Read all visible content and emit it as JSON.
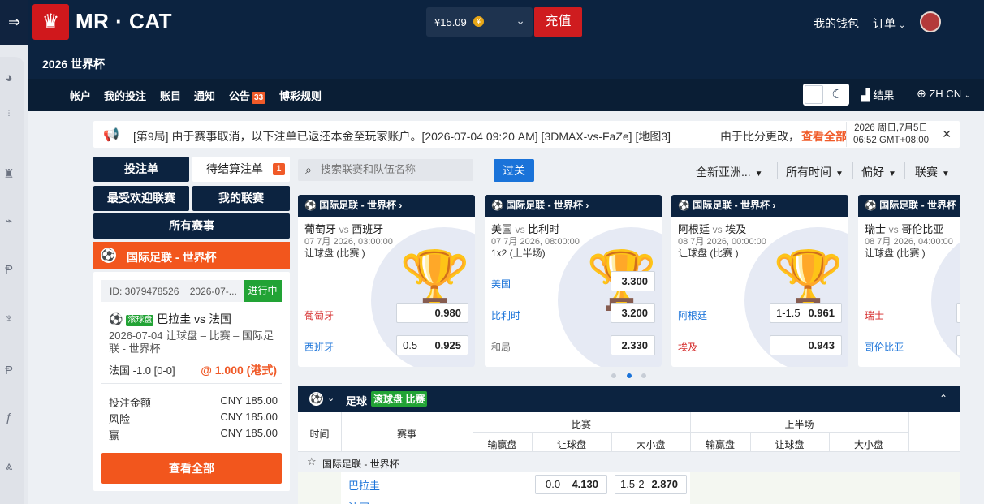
{
  "header": {
    "brand": "MR · CAT",
    "subtitle": "2026 世界杯",
    "balance": "¥15.09",
    "recharge": "充值",
    "wallet": "我的钱包",
    "orders": "订单"
  },
  "nav": {
    "items": [
      "帐户",
      "我的投注",
      "账目",
      "通知",
      "公告",
      "博彩规则"
    ],
    "announce_count": "33",
    "results": "结果",
    "lang": "ZH CN"
  },
  "marquee": {
    "text": "[第9局]      由于赛事取消，以下注单已返还本金至玩家账户。[2026-07-04 09:20 AM] [3DMAX-vs-FaZe] [地图3]",
    "text2": "由于比分更改，",
    "view_all": "查看全部",
    "date_line1": "2026 周日,7月5日",
    "date_line2": "06:52 GMT+08:00"
  },
  "left": {
    "tab_betslip": "投注单",
    "tab_pending": "待结算注单",
    "pending_count": "1",
    "btn_popular": "最受欢迎联赛",
    "btn_my_leagues": "我的联赛",
    "btn_all": "所有赛事",
    "league": "国际足联 - 世界杯",
    "bet": {
      "id": "ID: 3079478526",
      "date": "2026-07-...",
      "status": "进行中",
      "roll_tag": "滚球盘",
      "match": "巴拉圭 vs 法国",
      "desc": "2026-07-04 让球盘 – 比赛 – 国际足联 - 世界杯",
      "selection": "法国 -1.0 [0-0]",
      "odds": "@ 1.000 (港式)",
      "stake_label": "投注金额",
      "stake_value": "CNY 185.00",
      "risk_label": "风险",
      "risk_value": "CNY 185.00",
      "win_label": "赢",
      "win_value": "CNY 185.00",
      "view_all": "查看全部"
    }
  },
  "filters": {
    "search_placeholder": "搜索联赛和队伍名称",
    "filter_btn": "过关",
    "odds_type": "全新亚洲...",
    "time": "所有时间",
    "prefs": "偏好",
    "leagues": "联赛"
  },
  "cards": [
    {
      "league": "国际足联 - 世界杯",
      "home": "葡萄牙",
      "away": "西班牙",
      "vs": "vs",
      "time": "07 7月 2026, 03:00:00",
      "market": "让球盘 (比赛 )",
      "rows": [
        {
          "label": "葡萄牙",
          "line": "",
          "odds": "0.980"
        },
        {
          "label": "西班牙",
          "line": "0.5",
          "odds": "0.925"
        }
      ]
    },
    {
      "league": "国际足联 - 世界杯",
      "home": "美国",
      "away": "比利时",
      "vs": "vs",
      "time": "07 7月 2026, 08:00:00",
      "market": "1x2 (上半场)",
      "rows": [
        {
          "label": "美国",
          "line": "",
          "odds": "3.300"
        },
        {
          "label": "比利时",
          "line": "",
          "odds": "3.200"
        },
        {
          "label": "和局",
          "line": "",
          "odds": "2.330"
        }
      ]
    },
    {
      "league": "国际足联 - 世界杯",
      "home": "阿根廷",
      "away": "埃及",
      "vs": "vs",
      "time": "08 7月 2026, 00:00:00",
      "market": "让球盘 (比赛 )",
      "rows": [
        {
          "label": "阿根廷",
          "line": "1-1.5",
          "odds": "0.961"
        },
        {
          "label": "埃及",
          "line": "",
          "odds": "0.943"
        }
      ]
    },
    {
      "league": "国际足联 - 世界杯",
      "home": "瑞士",
      "away": "哥伦比亚",
      "vs": "vs",
      "time": "08 7月 2026, 04:00:00",
      "market": "让球盘 (比赛 )",
      "rows": [
        {
          "label": "瑞士",
          "line": "",
          "odds": ""
        },
        {
          "label": "哥伦比亚",
          "line": "",
          "odds": ""
        }
      ]
    }
  ],
  "table": {
    "sport": "足球",
    "mode": "滚球盘 比赛",
    "col_time": "时间",
    "col_event": "赛事",
    "group_full": "比赛",
    "group_half": "上半场",
    "sub_cols": [
      "输赢盘",
      "让球盘",
      "大小盘"
    ],
    "league": "国际足联 - 世界杯",
    "home": "巴拉圭",
    "away": "法国",
    "hdp_line": "0.0",
    "hdp_odds": "4.130",
    "ou_line": "1.5-2",
    "ou_odds": "2.870"
  },
  "colors": {
    "brand_navy": "#0c2340",
    "accent_orange": "#f2561d",
    "live_green": "#22a335",
    "recharge_red": "#cf1c1f",
    "link_blue": "#1a73d9"
  }
}
